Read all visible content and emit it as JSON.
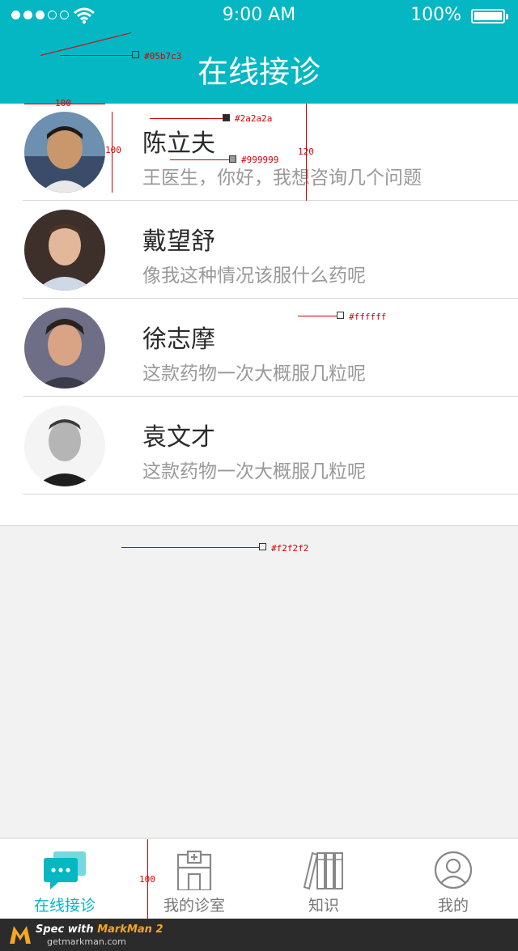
{
  "status_bar": {
    "time": "9:00 AM",
    "battery": "100%"
  },
  "nav": {
    "title": "在线接诊"
  },
  "patients": [
    {
      "name": "陈立夫",
      "message": "王医生，你好，我想咨询几个问题"
    },
    {
      "name": "戴望舒",
      "message": "像我这种情况该服什么药呢"
    },
    {
      "name": "徐志摩",
      "message": "这款药物一次大概服几粒呢"
    },
    {
      "name": "袁文才",
      "message": "这款药物一次大概服几粒呢"
    }
  ],
  "tabs": [
    {
      "label": "在线接诊",
      "icon": "chat-icon",
      "active": true
    },
    {
      "label": "我的诊室",
      "icon": "clinic-icon"
    },
    {
      "label": "知识",
      "icon": "books-icon"
    },
    {
      "label": "我的",
      "icon": "profile-icon"
    }
  ],
  "annotations": {
    "nav_color": "#05b7c3",
    "name_color": "#2a2a2a",
    "msg_color": "#999999",
    "list_bg": "#ffffff",
    "page_bg": "#f2f2f2",
    "avatar_width": "100",
    "avatar_height": "100",
    "row_height": "120",
    "tabbar_height": "100"
  },
  "footer": {
    "title_prefix": "Spec with ",
    "title_brand": "MarkMan 2",
    "url": "getmarkman.com"
  },
  "colors": {
    "accent": "#05b7c3",
    "text_primary": "#2a2a2a",
    "text_secondary": "#999999",
    "background": "#f2f2f2"
  }
}
